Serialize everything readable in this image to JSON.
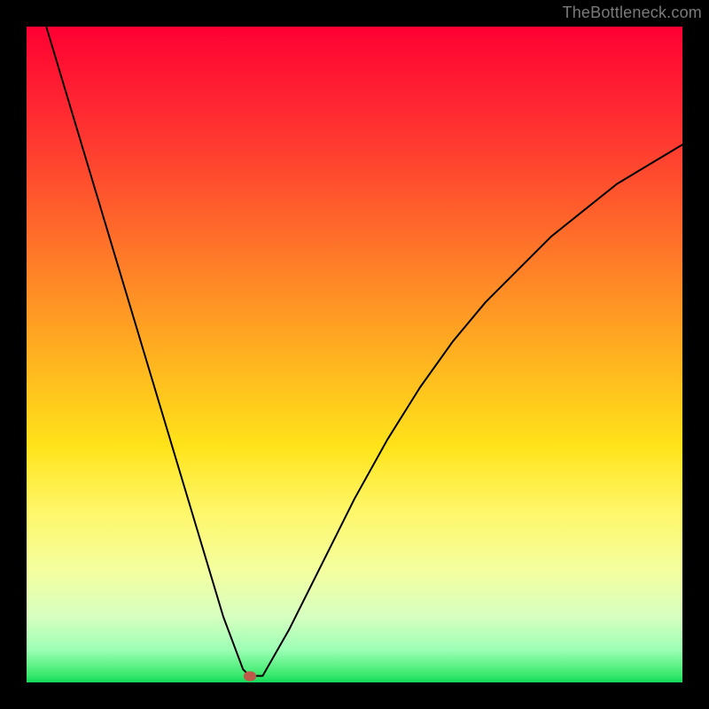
{
  "watermark": {
    "text": "TheBottleneck.com"
  },
  "colors": {
    "frame": "#000000",
    "gradient_top": "#ff0033",
    "gradient_bottom": "#12d85a",
    "curve": "#000000",
    "marker": "#be5a4a"
  },
  "chart_data": {
    "type": "line",
    "title": "",
    "xlabel": "",
    "ylabel": "",
    "xlim": [
      0,
      100
    ],
    "ylim": [
      0,
      100
    ],
    "grid": false,
    "legend": false,
    "series": [
      {
        "name": "bottleneck-curve",
        "x": [
          3,
          6,
          9,
          12,
          15,
          18,
          21,
          24,
          27,
          30,
          33,
          34,
          36,
          40,
          45,
          50,
          55,
          60,
          65,
          70,
          75,
          80,
          85,
          90,
          95,
          100
        ],
        "y": [
          100,
          90,
          80,
          70,
          60,
          50,
          40,
          30,
          20,
          10,
          2,
          1,
          1,
          8,
          18,
          28,
          37,
          45,
          52,
          58,
          63,
          68,
          72,
          76,
          79,
          82
        ]
      }
    ],
    "marker": {
      "x": 34,
      "y": 1
    },
    "annotations": []
  }
}
